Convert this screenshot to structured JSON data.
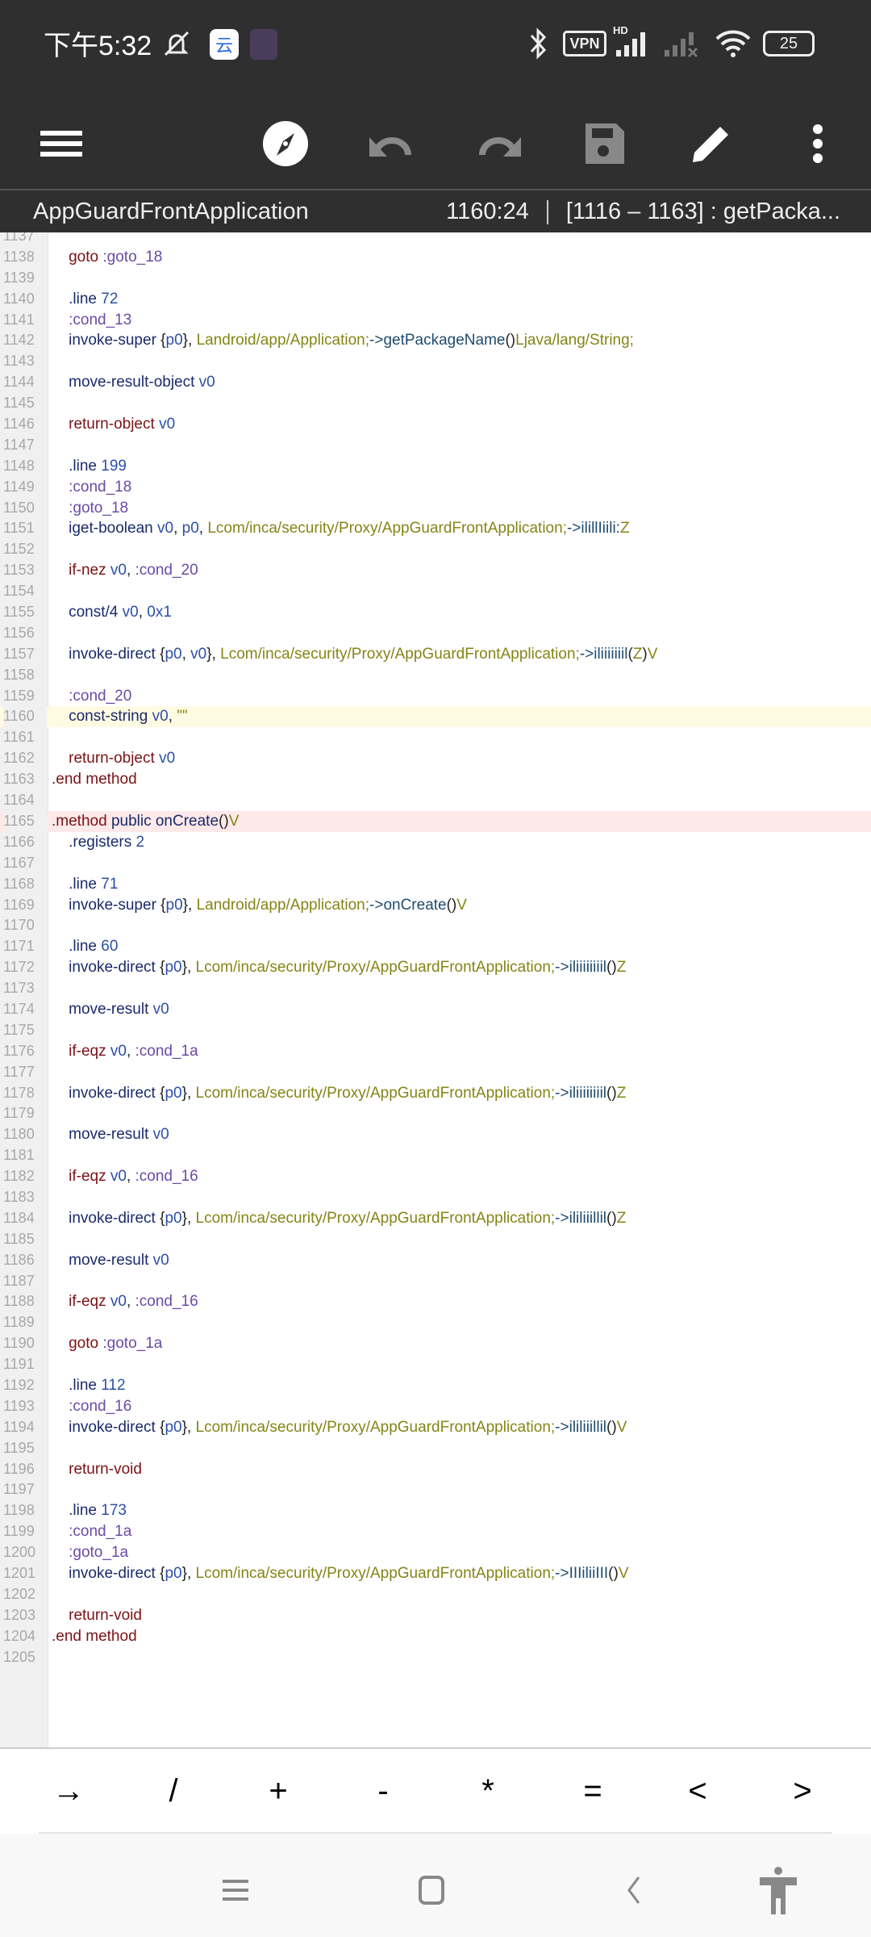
{
  "status_bar": {
    "time": "下午5:32",
    "vpn": "VPN",
    "hd": "HD",
    "battery": "25",
    "icons": [
      "mute-bell-icon",
      "cloud-app-icon",
      "game-app-icon",
      "bluetooth-icon",
      "vpn-icon",
      "signal-icon",
      "signal-off-icon",
      "wifi-icon",
      "battery-icon"
    ]
  },
  "toolbar": {
    "icons": [
      "menu-icon",
      "compass-icon",
      "undo-icon",
      "redo-icon",
      "save-icon",
      "edit-icon",
      "more-icon"
    ]
  },
  "subheader": {
    "file_name": "AppGuardFrontApplication",
    "cursor": "1160:24",
    "range": "[1116 – 1163] : getPacka..."
  },
  "editor": {
    "current_line": 1160,
    "error_line": 1165,
    "lines": [
      {
        "n": "1137",
        "t": []
      },
      {
        "n": "1138",
        "t": [
          [
            "    goto ",
            "kw"
          ],
          [
            ":goto_18",
            "lab"
          ]
        ]
      },
      {
        "n": "1139",
        "t": []
      },
      {
        "n": "1140",
        "t": [
          [
            "    .line ",
            "ins"
          ],
          [
            "72",
            "num2"
          ]
        ]
      },
      {
        "n": "1141",
        "t": [
          [
            "    :cond_13",
            "lab"
          ]
        ]
      },
      {
        "n": "1142",
        "t": [
          [
            "    invoke-super ",
            "ins"
          ],
          [
            "{",
            "pun"
          ],
          [
            "p0",
            "reg"
          ],
          [
            "}, ",
            "pun"
          ],
          [
            "Landroid/app/Application;",
            "typ"
          ],
          [
            "->getPackageName",
            "mem"
          ],
          [
            "()",
            "pun"
          ],
          [
            "Ljava/lang/String;",
            "typ"
          ]
        ]
      },
      {
        "n": "1143",
        "t": []
      },
      {
        "n": "1144",
        "t": [
          [
            "    move-result-object ",
            "ins"
          ],
          [
            "v0",
            "reg"
          ]
        ]
      },
      {
        "n": "1145",
        "t": []
      },
      {
        "n": "1146",
        "t": [
          [
            "    return-object ",
            "kw"
          ],
          [
            "v0",
            "reg"
          ]
        ]
      },
      {
        "n": "1147",
        "t": []
      },
      {
        "n": "1148",
        "t": [
          [
            "    .line ",
            "ins"
          ],
          [
            "199",
            "num2"
          ]
        ]
      },
      {
        "n": "1149",
        "t": [
          [
            "    :cond_18",
            "lab"
          ]
        ]
      },
      {
        "n": "1150",
        "t": [
          [
            "    :goto_18",
            "lab"
          ]
        ]
      },
      {
        "n": "1151",
        "t": [
          [
            "    iget-boolean ",
            "ins"
          ],
          [
            "v0",
            "reg"
          ],
          [
            ", ",
            "pun"
          ],
          [
            "p0",
            "reg"
          ],
          [
            ", ",
            "pun"
          ],
          [
            "Lcom/inca/security/Proxy/AppGuardFrontApplication;",
            "typ"
          ],
          [
            "->ilillIiili:",
            "mem"
          ],
          [
            "Z",
            "typ"
          ]
        ]
      },
      {
        "n": "1152",
        "t": []
      },
      {
        "n": "1153",
        "t": [
          [
            "    if-nez ",
            "kw"
          ],
          [
            "v0",
            "reg"
          ],
          [
            ", ",
            "pun"
          ],
          [
            ":cond_20",
            "lab"
          ]
        ]
      },
      {
        "n": "1154",
        "t": []
      },
      {
        "n": "1155",
        "t": [
          [
            "    const/4 ",
            "ins"
          ],
          [
            "v0",
            "reg"
          ],
          [
            ", ",
            "pun"
          ],
          [
            "0x1",
            "num2"
          ]
        ]
      },
      {
        "n": "1156",
        "t": []
      },
      {
        "n": "1157",
        "t": [
          [
            "    invoke-direct ",
            "ins"
          ],
          [
            "{",
            "pun"
          ],
          [
            "p0",
            "reg"
          ],
          [
            ", ",
            "pun"
          ],
          [
            "v0",
            "reg"
          ],
          [
            "}, ",
            "pun"
          ],
          [
            "Lcom/inca/security/Proxy/AppGuardFrontApplication;",
            "typ"
          ],
          [
            "->iliiiiiiil",
            "mem"
          ],
          [
            "(",
            "pun"
          ],
          [
            "Z",
            "typ"
          ],
          [
            ")",
            "pun"
          ],
          [
            "V",
            "typ"
          ]
        ]
      },
      {
        "n": "1158",
        "t": []
      },
      {
        "n": "1159",
        "t": [
          [
            "    :cond_20",
            "lab"
          ]
        ]
      },
      {
        "n": "1160",
        "t": [
          [
            "    const-string ",
            "ins"
          ],
          [
            "v0",
            "reg"
          ],
          [
            ", ",
            "pun"
          ],
          [
            "\"\"",
            "typ"
          ]
        ]
      },
      {
        "n": "1161",
        "t": []
      },
      {
        "n": "1162",
        "t": [
          [
            "    return-object ",
            "kw"
          ],
          [
            "v0",
            "reg"
          ]
        ]
      },
      {
        "n": "1163",
        "t": [
          [
            ".end method",
            "kw"
          ]
        ]
      },
      {
        "n": "1164",
        "t": []
      },
      {
        "n": "1165",
        "t": [
          [
            ".method ",
            "kw"
          ],
          [
            "public ",
            "ins"
          ],
          [
            "onCreate",
            "ins"
          ],
          [
            "()",
            "pun"
          ],
          [
            "V",
            "typ"
          ]
        ]
      },
      {
        "n": "1166",
        "t": [
          [
            "    .registers ",
            "ins"
          ],
          [
            "2",
            "num2"
          ]
        ]
      },
      {
        "n": "1167",
        "t": []
      },
      {
        "n": "1168",
        "t": [
          [
            "    .line ",
            "ins"
          ],
          [
            "71",
            "num2"
          ]
        ]
      },
      {
        "n": "1169",
        "t": [
          [
            "    invoke-super ",
            "ins"
          ],
          [
            "{",
            "pun"
          ],
          [
            "p0",
            "reg"
          ],
          [
            "}, ",
            "pun"
          ],
          [
            "Landroid/app/Application;",
            "typ"
          ],
          [
            "->onCreate",
            "mem"
          ],
          [
            "()",
            "pun"
          ],
          [
            "V",
            "typ"
          ]
        ]
      },
      {
        "n": "1170",
        "t": []
      },
      {
        "n": "1171",
        "t": [
          [
            "    .line ",
            "ins"
          ],
          [
            "60",
            "num2"
          ]
        ]
      },
      {
        "n": "1172",
        "t": [
          [
            "    invoke-direct ",
            "ins"
          ],
          [
            "{",
            "pun"
          ],
          [
            "p0",
            "reg"
          ],
          [
            "}, ",
            "pun"
          ],
          [
            "Lcom/inca/security/Proxy/AppGuardFrontApplication;",
            "typ"
          ],
          [
            "->iliiiiiiiil",
            "mem"
          ],
          [
            "()",
            "pun"
          ],
          [
            "Z",
            "typ"
          ]
        ]
      },
      {
        "n": "1173",
        "t": []
      },
      {
        "n": "1174",
        "t": [
          [
            "    move-result ",
            "ins"
          ],
          [
            "v0",
            "reg"
          ]
        ]
      },
      {
        "n": "1175",
        "t": []
      },
      {
        "n": "1176",
        "t": [
          [
            "    if-eqz ",
            "kw"
          ],
          [
            "v0",
            "reg"
          ],
          [
            ", ",
            "pun"
          ],
          [
            ":cond_1a",
            "lab"
          ]
        ]
      },
      {
        "n": "1177",
        "t": []
      },
      {
        "n": "1178",
        "t": [
          [
            "    invoke-direct ",
            "ins"
          ],
          [
            "{",
            "pun"
          ],
          [
            "p0",
            "reg"
          ],
          [
            "}, ",
            "pun"
          ],
          [
            "Lcom/inca/security/Proxy/AppGuardFrontApplication;",
            "typ"
          ],
          [
            "->iliiiiiiiil",
            "mem"
          ],
          [
            "()",
            "pun"
          ],
          [
            "Z",
            "typ"
          ]
        ]
      },
      {
        "n": "1179",
        "t": []
      },
      {
        "n": "1180",
        "t": [
          [
            "    move-result ",
            "ins"
          ],
          [
            "v0",
            "reg"
          ]
        ]
      },
      {
        "n": "1181",
        "t": []
      },
      {
        "n": "1182",
        "t": [
          [
            "    if-eqz ",
            "kw"
          ],
          [
            "v0",
            "reg"
          ],
          [
            ", ",
            "pun"
          ],
          [
            ":cond_16",
            "lab"
          ]
        ]
      },
      {
        "n": "1183",
        "t": []
      },
      {
        "n": "1184",
        "t": [
          [
            "    invoke-direct ",
            "ins"
          ],
          [
            "{",
            "pun"
          ],
          [
            "p0",
            "reg"
          ],
          [
            "}, ",
            "pun"
          ],
          [
            "Lcom/inca/security/Proxy/AppGuardFrontApplication;",
            "typ"
          ],
          [
            "->ililiiillil",
            "mem"
          ],
          [
            "()",
            "pun"
          ],
          [
            "Z",
            "typ"
          ]
        ]
      },
      {
        "n": "1185",
        "t": []
      },
      {
        "n": "1186",
        "t": [
          [
            "    move-result ",
            "ins"
          ],
          [
            "v0",
            "reg"
          ]
        ]
      },
      {
        "n": "1187",
        "t": []
      },
      {
        "n": "1188",
        "t": [
          [
            "    if-eqz ",
            "kw"
          ],
          [
            "v0",
            "reg"
          ],
          [
            ", ",
            "pun"
          ],
          [
            ":cond_16",
            "lab"
          ]
        ]
      },
      {
        "n": "1189",
        "t": []
      },
      {
        "n": "1190",
        "t": [
          [
            "    goto ",
            "kw"
          ],
          [
            ":goto_1a",
            "lab"
          ]
        ]
      },
      {
        "n": "1191",
        "t": []
      },
      {
        "n": "1192",
        "t": [
          [
            "    .line ",
            "ins"
          ],
          [
            "112",
            "num2"
          ]
        ]
      },
      {
        "n": "1193",
        "t": [
          [
            "    :cond_16",
            "lab"
          ]
        ]
      },
      {
        "n": "1194",
        "t": [
          [
            "    invoke-direct ",
            "ins"
          ],
          [
            "{",
            "pun"
          ],
          [
            "p0",
            "reg"
          ],
          [
            "}, ",
            "pun"
          ],
          [
            "Lcom/inca/security/Proxy/AppGuardFrontApplication;",
            "typ"
          ],
          [
            "->ililiiillil",
            "mem"
          ],
          [
            "()",
            "pun"
          ],
          [
            "V",
            "typ"
          ]
        ]
      },
      {
        "n": "1195",
        "t": []
      },
      {
        "n": "1196",
        "t": [
          [
            "    return-void",
            "kw"
          ]
        ]
      },
      {
        "n": "1197",
        "t": []
      },
      {
        "n": "1198",
        "t": [
          [
            "    .line ",
            "ins"
          ],
          [
            "173",
            "num2"
          ]
        ]
      },
      {
        "n": "1199",
        "t": [
          [
            "    :cond_1a",
            "lab"
          ]
        ]
      },
      {
        "n": "1200",
        "t": [
          [
            "    :goto_1a",
            "lab"
          ]
        ]
      },
      {
        "n": "1201",
        "t": [
          [
            "    invoke-direct ",
            "ins"
          ],
          [
            "{",
            "pun"
          ],
          [
            "p0",
            "reg"
          ],
          [
            "}, ",
            "pun"
          ],
          [
            "Lcom/inca/security/Proxy/AppGuardFrontApplication;",
            "typ"
          ],
          [
            "->IIIiliiIII",
            "mem"
          ],
          [
            "()",
            "pun"
          ],
          [
            "V",
            "typ"
          ]
        ]
      },
      {
        "n": "1202",
        "t": []
      },
      {
        "n": "1203",
        "t": [
          [
            "    return-void",
            "kw"
          ]
        ]
      },
      {
        "n": "1204",
        "t": [
          [
            ".end method",
            "kw"
          ]
        ]
      },
      {
        "n": "1205",
        "t": []
      }
    ]
  },
  "symbol_keys": [
    "→",
    "/",
    "+",
    "-",
    "*",
    "=",
    "<",
    ">"
  ],
  "nav_bar": {
    "icons": [
      "recents-icon",
      "home-icon",
      "back-icon",
      "accessibility-icon"
    ]
  },
  "colors": {
    "bar": "#2f2f2f",
    "keyword": "#7b1216",
    "instruction": "#1b2a6c",
    "label": "#6a4ba6",
    "register": "#2c4fa8",
    "type": "#858517",
    "member": "#1f4b6e",
    "current_line": "#fffbe3",
    "error_line": "#fde9e9"
  }
}
